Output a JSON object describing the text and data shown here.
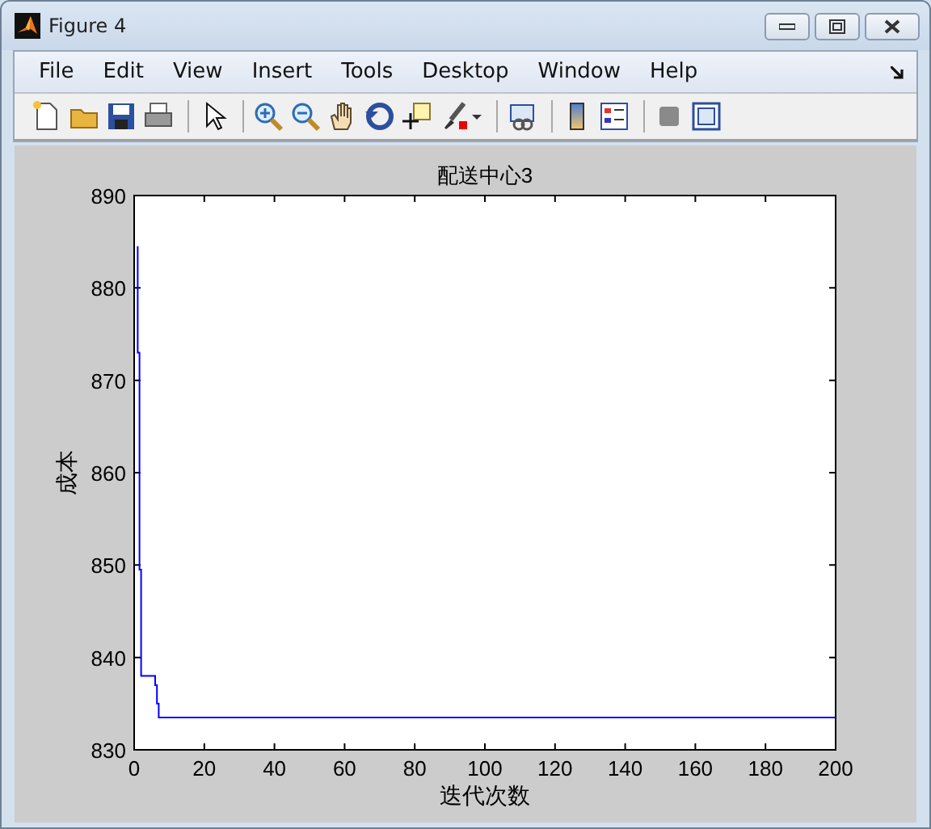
{
  "window": {
    "title": "Figure 4"
  },
  "menu": [
    "File",
    "Edit",
    "View",
    "Insert",
    "Tools",
    "Desktop",
    "Window",
    "Help"
  ],
  "figure": {
    "chart_data": {
      "type": "line",
      "title": "配送中心3",
      "xlabel": "迭代次数",
      "ylabel": "成本",
      "xlim": [
        0,
        200
      ],
      "ylim": [
        830,
        890
      ],
      "xticks": [
        0,
        20,
        40,
        60,
        80,
        100,
        120,
        140,
        160,
        180,
        200
      ],
      "yticks": [
        830,
        840,
        850,
        860,
        870,
        880,
        890
      ],
      "x": [
        1,
        1,
        1.5,
        1.5,
        2,
        2,
        6,
        6,
        6.5,
        6.5,
        7,
        7,
        200
      ],
      "series": [
        {
          "color": "#0000ff",
          "values": [
            884.5,
            873,
            873,
            849.5,
            849.5,
            838,
            838,
            837,
            837,
            835,
            835,
            833.5,
            833.5
          ]
        }
      ]
    }
  }
}
